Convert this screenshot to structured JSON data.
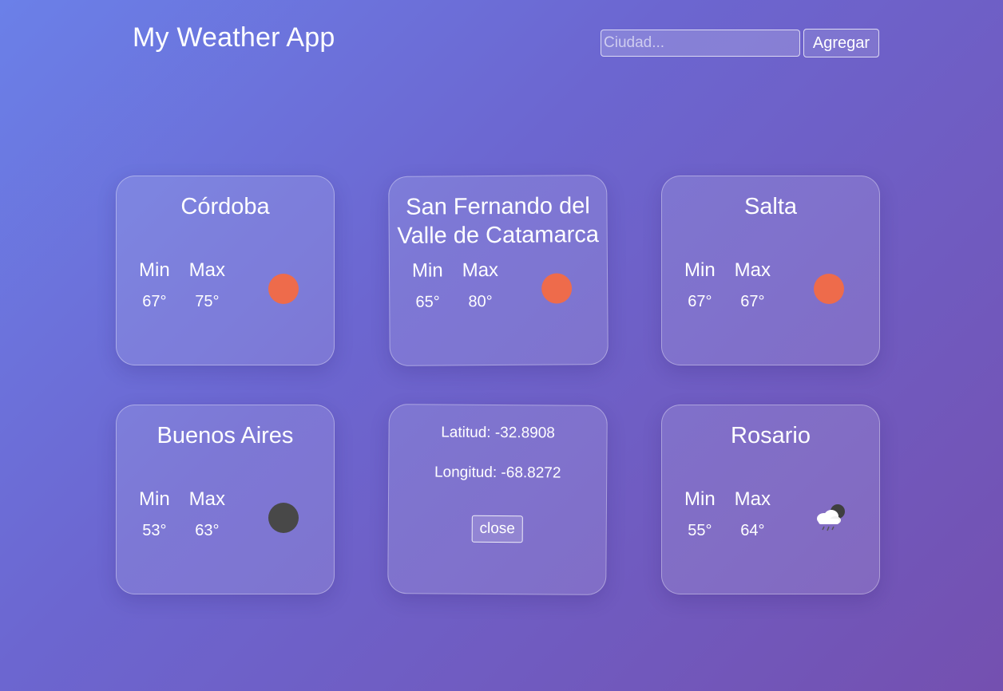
{
  "app": {
    "title": "My Weather App"
  },
  "search": {
    "placeholder": "Ciudad...",
    "value": "",
    "button_label": "Agregar"
  },
  "labels": {
    "min": "Min",
    "max": "Max"
  },
  "cards": [
    {
      "city": "Córdoba",
      "min": "67°",
      "max": "75°",
      "icon": "sun-icon",
      "icon_color": "#ee6b4b"
    },
    {
      "city": "San Fernando del Valle de Catamarca",
      "min": "65°",
      "max": "80°",
      "icon": "sun-icon",
      "icon_color": "#ee6b4b"
    },
    {
      "city": "Salta",
      "min": "67°",
      "max": "67°",
      "icon": "sun-icon",
      "icon_color": "#ee6b4b"
    },
    {
      "city": "Buenos Aires",
      "min": "53°",
      "max": "63°",
      "icon": "night-icon",
      "icon_color": "#484848"
    },
    {
      "city": "Rosario",
      "min": "55°",
      "max": "64°",
      "icon": "rain-cloud-icon",
      "icon_color": "#ffffff"
    }
  ],
  "detail": {
    "latitude": "Latitud: -32.8908",
    "longitude": "Longitud: -68.8272",
    "close_label": "close"
  }
}
